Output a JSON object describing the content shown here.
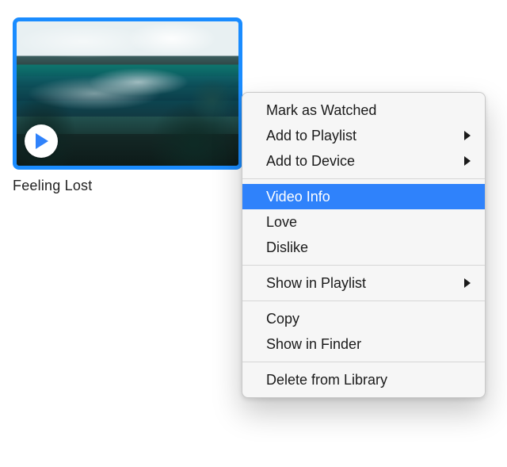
{
  "video": {
    "title": "Feeling Lost",
    "thumbnail_desc": "ocean-coast-scene",
    "play_icon": "play-icon"
  },
  "context_menu": {
    "items": [
      {
        "label": "Mark as Watched",
        "has_submenu": false
      },
      {
        "label": "Add to Playlist",
        "has_submenu": true
      },
      {
        "label": "Add to Device",
        "has_submenu": true
      }
    ],
    "items2": [
      {
        "label": "Video Info",
        "highlighted": true
      },
      {
        "label": "Love"
      },
      {
        "label": "Dislike"
      }
    ],
    "items3": [
      {
        "label": "Show in Playlist",
        "has_submenu": true
      }
    ],
    "items4": [
      {
        "label": "Copy"
      },
      {
        "label": "Show in Finder"
      }
    ],
    "items5": [
      {
        "label": "Delete from Library"
      }
    ]
  }
}
